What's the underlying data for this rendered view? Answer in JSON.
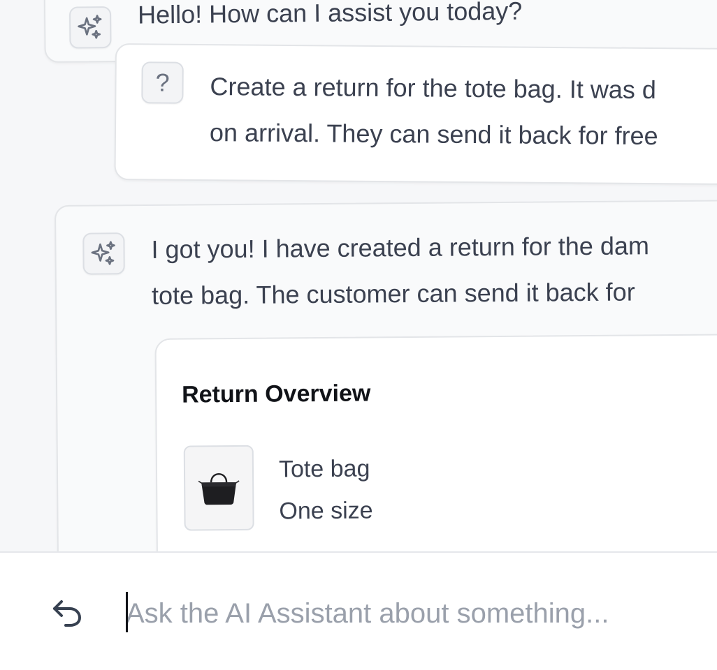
{
  "messages": [
    {
      "role": "assistant",
      "text_lines": [
        "Hello! How can I assist you today?"
      ]
    },
    {
      "role": "user",
      "avatar_glyph": "?",
      "text_lines": [
        "Create a return for the tote bag. It was d",
        "on arrival. They can send it back for free"
      ]
    },
    {
      "role": "assistant",
      "text_lines": [
        "I got you! I have created a return for the dam",
        "tote bag. The customer can send it back for"
      ]
    }
  ],
  "return_overview": {
    "title": "Return Overview",
    "item": {
      "name": "Tote bag",
      "variant": "One size",
      "image_icon": "tote-bag-image"
    }
  },
  "composer": {
    "placeholder": "Ask the AI Assistant about something...",
    "value": "",
    "back_icon": "undo-arrow-icon"
  },
  "icons": {
    "assistant_avatar": "sparkles-icon",
    "user_avatar": "question-mark-icon"
  },
  "colors": {
    "background": "#f6f7f9",
    "text": "#3b4150",
    "placeholder": "#9aa0ab"
  }
}
